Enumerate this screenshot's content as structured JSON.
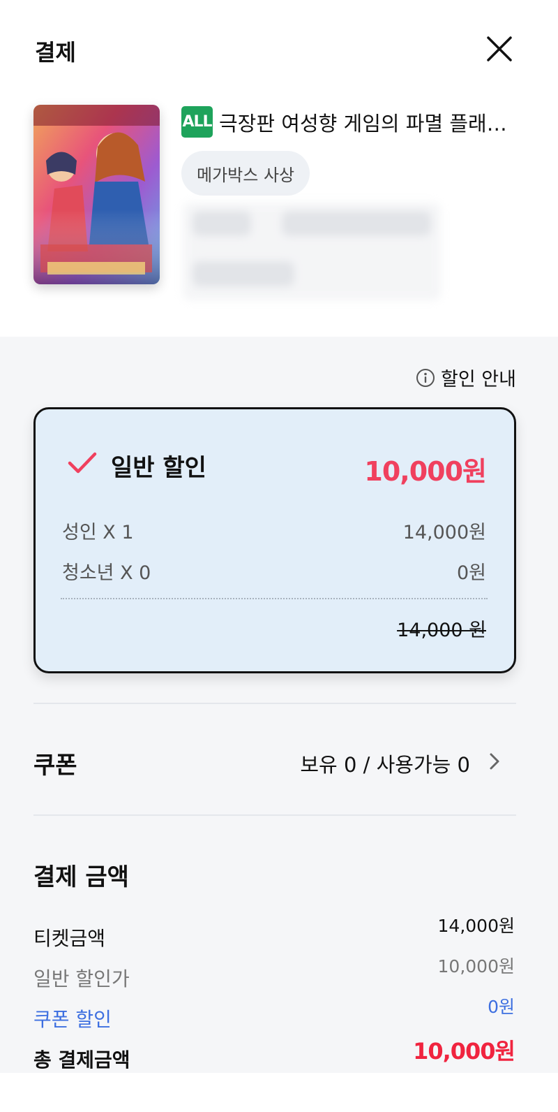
{
  "header": {
    "title": "결제",
    "close_icon": "close-icon"
  },
  "movie": {
    "rating": "ALL",
    "title": "극장판 여성향 게임의 파멸 플래…",
    "theater": "메가박스 사상",
    "rating_color": "#1ea35b"
  },
  "discount_info": {
    "label": "할인 안내",
    "icon": "info-icon"
  },
  "discount_card": {
    "label": "일반 할인",
    "price": "10,000원",
    "rows": [
      {
        "label": "성인 X 1",
        "value": "14,000원"
      },
      {
        "label": "청소년 X 0",
        "value": "0원"
      }
    ],
    "original_price": "14,000 원",
    "accent_color": "#f0405e"
  },
  "coupon": {
    "title": "쿠폰",
    "status": "보유 0 / 사용가능 0"
  },
  "payment": {
    "title": "결제 금액",
    "items": [
      {
        "label": "티켓금액",
        "value": "14,000원"
      },
      {
        "label": "일반 할인가",
        "value": "10,000원"
      },
      {
        "label": "쿠폰 할인",
        "value": "0원"
      },
      {
        "label": "총 결제금액",
        "value": "10,000원"
      }
    ],
    "coupon_color": "#3d6fe0",
    "total_color": "#f0243f"
  }
}
